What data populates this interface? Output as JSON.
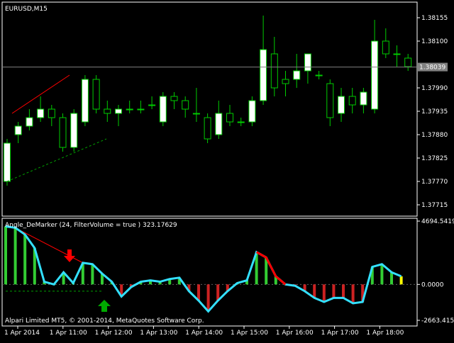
{
  "window": {
    "symbol_label": "EURUSD,M15",
    "indicator_label": "Angle_DeMarker (24, FilterVolume = true ) 323.17629",
    "copyright": "Alpari Limited MT5, © 2001-2014, MetaQuotes Software Corp.",
    "current_price": "1.38039"
  },
  "price_axis": {
    "ticks": [
      {
        "label": "1.38155",
        "value": 1.38155
      },
      {
        "label": "1.38100",
        "value": 1.381
      },
      {
        "label": "1.37990",
        "value": 1.3799
      },
      {
        "label": "1.37935",
        "value": 1.37935
      },
      {
        "label": "1.37880",
        "value": 1.3788
      },
      {
        "label": "1.37825",
        "value": 1.37825
      },
      {
        "label": "1.37770",
        "value": 1.3777
      },
      {
        "label": "1.37715",
        "value": 1.37715
      }
    ]
  },
  "indicator_axis": {
    "ticks": [
      {
        "label": "4694.54196",
        "value": 4694.54196
      },
      {
        "label": "0.0000",
        "value": 0
      },
      {
        "label": "-2663.41541",
        "value": -2663.41541
      }
    ]
  },
  "time_axis": {
    "ticks": [
      "1 Apr 2014",
      "1 Apr 11:00",
      "1 Apr 12:00",
      "1 Apr 13:00",
      "1 Apr 14:00",
      "1 Apr 15:00",
      "1 Apr 16:00",
      "1 Apr 17:00",
      "1 Apr 18:00"
    ]
  },
  "colors": {
    "background": "#000000",
    "axis": "#ffffff",
    "bull_candle": "#ffffff",
    "bear_candle": "#000000",
    "candle_wick": "#00cc00",
    "current_price_line": "#808080",
    "trendline_red": "#ff0000",
    "trendline_green": "#00a000",
    "indicator_line": "#33e0ff",
    "indicator_line_up": "#ff0000",
    "hist_positive": "#33cc33",
    "hist_negative": "#cc2222",
    "hist_neutral": "#ffff00",
    "arrow_down": "#ff0000",
    "arrow_up": "#00aa00"
  },
  "chart_data": [
    {
      "type": "candlestick",
      "title": "EURUSD,M15",
      "ylim": [
        1.3769,
        1.3819
      ],
      "series": [
        {
          "name": "EURUSD",
          "ohlc": [
            [
              1.3777,
              1.3787,
              1.3776,
              1.3786
            ],
            [
              1.3788,
              1.3791,
              1.3786,
              1.379
            ],
            [
              1.379,
              1.3794,
              1.3789,
              1.3792
            ],
            [
              1.3792,
              1.3797,
              1.3791,
              1.3794
            ],
            [
              1.3794,
              1.3795,
              1.379,
              1.3792
            ],
            [
              1.3792,
              1.3793,
              1.3784,
              1.3785
            ],
            [
              1.3785,
              1.3794,
              1.3784,
              1.3793
            ],
            [
              1.3791,
              1.3802,
              1.379,
              1.3801
            ],
            [
              1.3801,
              1.3802,
              1.3793,
              1.3794
            ],
            [
              1.3794,
              1.3796,
              1.3791,
              1.3793
            ],
            [
              1.3793,
              1.3795,
              1.379,
              1.3794
            ],
            [
              1.3794,
              1.3796,
              1.3793,
              1.3794
            ],
            [
              1.3794,
              1.3796,
              1.3793,
              1.3794
            ],
            [
              1.3795,
              1.3797,
              1.3794,
              1.3795
            ],
            [
              1.3791,
              1.3798,
              1.379,
              1.3797
            ],
            [
              1.3797,
              1.3798,
              1.3794,
              1.3796
            ],
            [
              1.3796,
              1.3797,
              1.3792,
              1.3794
            ],
            [
              1.3793,
              1.3799,
              1.3791,
              1.3793
            ],
            [
              1.3792,
              1.3793,
              1.3786,
              1.3787
            ],
            [
              1.3788,
              1.3796,
              1.3787,
              1.3793
            ],
            [
              1.3793,
              1.3795,
              1.379,
              1.3791
            ],
            [
              1.3791,
              1.3792,
              1.379,
              1.3791
            ],
            [
              1.3791,
              1.3797,
              1.379,
              1.3796
            ],
            [
              1.3796,
              1.3816,
              1.3795,
              1.3808
            ],
            [
              1.3807,
              1.3811,
              1.3797,
              1.3799
            ],
            [
              1.3801,
              1.3803,
              1.3797,
              1.38
            ],
            [
              1.3801,
              1.3807,
              1.3799,
              1.3803
            ],
            [
              1.3803,
              1.3807,
              1.38,
              1.3807
            ],
            [
              1.3802,
              1.3803,
              1.3801,
              1.3802
            ],
            [
              1.38,
              1.3801,
              1.379,
              1.3792
            ],
            [
              1.3793,
              1.3799,
              1.3791,
              1.3797
            ],
            [
              1.3797,
              1.3799,
              1.3793,
              1.3795
            ],
            [
              1.3795,
              1.3799,
              1.3793,
              1.3798
            ],
            [
              1.3794,
              1.3815,
              1.3793,
              1.381
            ],
            [
              1.381,
              1.3813,
              1.3806,
              1.3807
            ],
            [
              1.3807,
              1.3809,
              1.3804,
              1.3807
            ],
            [
              1.3806,
              1.3807,
              1.3803,
              1.3804
            ]
          ]
        }
      ]
    },
    {
      "type": "line",
      "title": "Angle_DeMarker (24, FilterVolume = true ) 323.17629",
      "ylim": [
        -2663.41541,
        4694.54196
      ],
      "series": [
        {
          "name": "Angle_DeMarker",
          "values": [
            4300,
            4200,
            3700,
            2700,
            200,
            0,
            900,
            100,
            1600,
            1500,
            800,
            200,
            -900,
            -200,
            200,
            300,
            200,
            400,
            500,
            -500,
            -1200,
            -2000,
            -1200,
            -500,
            100,
            300,
            2400,
            2000,
            600,
            0,
            -100,
            -500,
            -1000,
            -1300,
            -1000,
            -1000,
            -1400,
            -1300,
            1300,
            1500,
            900,
            600
          ]
        },
        {
          "name": "histogram",
          "values": [
            4300,
            4200,
            3700,
            2700,
            200,
            0,
            900,
            100,
            1600,
            1500,
            800,
            200,
            -900,
            -200,
            200,
            300,
            200,
            400,
            500,
            -500,
            -1200,
            -2000,
            -1200,
            -500,
            100,
            300,
            2400,
            2000,
            600,
            0,
            -100,
            -500,
            -1000,
            -1300,
            -1000,
            -1000,
            -1400,
            -1300,
            1300,
            1500,
            900,
            600
          ]
        }
      ]
    }
  ]
}
